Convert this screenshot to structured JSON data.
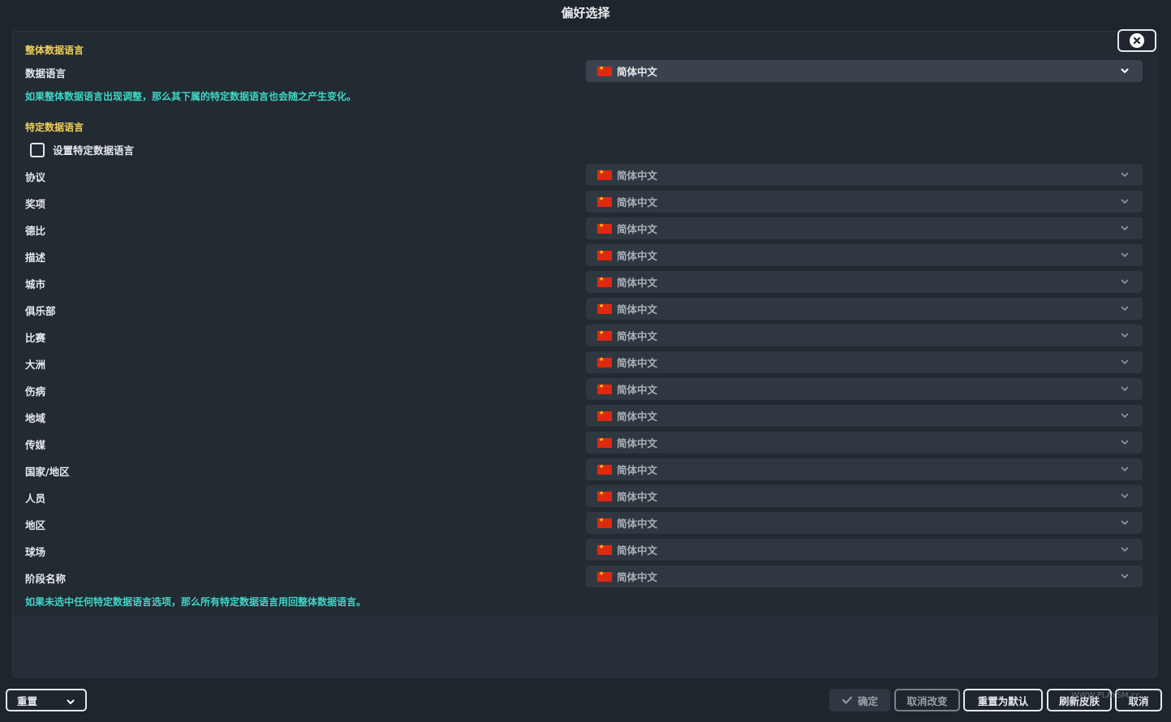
{
  "window": {
    "title": "偏好选择"
  },
  "overall": {
    "section_title": "整体数据语言",
    "label": "数据语言",
    "value": "简体中文",
    "hint": "如果整体数据语言出现调整，那么其下属的特定数据语言也会随之产生变化。"
  },
  "specific": {
    "section_title": "特定数据语言",
    "checkbox_label": "设置特定数据语言",
    "checkbox_checked": false,
    "rows": [
      {
        "label": "协议",
        "value": "简体中文"
      },
      {
        "label": "奖项",
        "value": "简体中文"
      },
      {
        "label": "德比",
        "value": "简体中文"
      },
      {
        "label": "描述",
        "value": "简体中文"
      },
      {
        "label": "城市",
        "value": "简体中文"
      },
      {
        "label": "俱乐部",
        "value": "简体中文"
      },
      {
        "label": "比赛",
        "value": "简体中文"
      },
      {
        "label": "大洲",
        "value": "简体中文"
      },
      {
        "label": "伤病",
        "value": "简体中文"
      },
      {
        "label": "地域",
        "value": "简体中文"
      },
      {
        "label": "传媒",
        "value": "简体中文"
      },
      {
        "label": "国家/地区",
        "value": "简体中文"
      },
      {
        "label": "人员",
        "value": "简体中文"
      },
      {
        "label": "地区",
        "value": "简体中文"
      },
      {
        "label": "球场",
        "value": "简体中文"
      },
      {
        "label": "阶段名称",
        "value": "简体中文"
      }
    ],
    "hint": "如果未选中任何特定数据语言选项，那么所有特定数据语言用回整体数据语言。"
  },
  "footer": {
    "reset_label": "重置",
    "confirm_label": "确定",
    "cancel_changes_label": "取消改变",
    "reset_default_label": "重置为默认",
    "refresh_skin_label": "刷新皮肤",
    "cancel_label": "取消",
    "watermark": "WWW.PLAYSM.cc"
  },
  "colors": {
    "section_title": "#f2d15a",
    "hint": "#3fd6c9",
    "background": "#1e252d",
    "dropdown": "#353e48"
  },
  "icons": {
    "close": "close-circle-icon",
    "chevron": "chevron-down-icon",
    "flag": "china-flag-icon",
    "check": "check-icon"
  }
}
